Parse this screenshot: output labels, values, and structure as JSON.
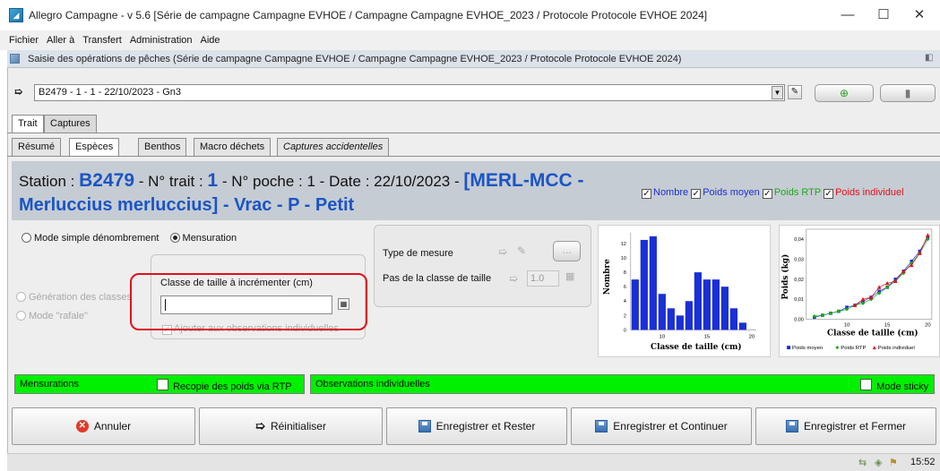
{
  "window": {
    "title": "Allegro Campagne - v 5.6 [Série de campagne Campagne EVHOE / Campagne Campagne EVHOE_2023 / Protocole Protocole EVHOE 2024]"
  },
  "menu": [
    "Fichier",
    "Aller à",
    "Transfert",
    "Administration",
    "Aide"
  ],
  "frame": {
    "title": "Saisie des opérations de pêches (Série de campagne Campagne EVHOE / Campagne Campagne EVHOE_2023 / Protocole Protocole EVHOE 2024)"
  },
  "trip_selector": {
    "value": "B2479 - 1 - 1 - 22/10/2023 - Gn3"
  },
  "top_tabs": [
    "Trait",
    "Captures"
  ],
  "sub_tabs": [
    "Résumé",
    "Espèces",
    "Benthos",
    "Macro déchets",
    "Captures accidentelles"
  ],
  "station": {
    "station_label": "Station : ",
    "station_value": "B2479",
    "trait_label": " - N° trait : ",
    "trait_value": "1",
    "poche_text": " - N° poche : 1 - Date : 22/10/2023 - ",
    "species_part1": "[MERL-MCC -",
    "species_part2": "Merluccius merluccius] - Vrac - P - Petit"
  },
  "legend_checks": {
    "nombre": "Nombre",
    "poids_moyen": "Poids moyen",
    "poids_rtp": "Poids RTP",
    "poids_individuel": "Poids individuel",
    "colors": {
      "nombre": "#1a2fd6",
      "poids_moyen": "#1a2fd6",
      "poids_rtp": "#1aa81a",
      "poids_individuel": "#e0111c"
    }
  },
  "mode": {
    "simple": "Mode simple dénombrement",
    "mensuration": "Mensuration",
    "generation": "Génération des classes",
    "rafale": "Mode \"rafale\""
  },
  "classe": {
    "label": "Classe de taille à incrémenter (cm)",
    "value": "",
    "add_obs": "Ajouter aux observations individuelles"
  },
  "mesure": {
    "type_label": "Type de mesure",
    "pas_label": "Pas de la classe de taille",
    "pas_value": "1.0",
    "dots_button": "..."
  },
  "bottom_bars": {
    "mensurations": "Mensurations",
    "recopie": "Recopie des poids via RTP",
    "observations": "Observations individuelles",
    "sticky": "Mode sticky"
  },
  "buttons": {
    "annuler": "Annuler",
    "reinitialiser": "Réinitialiser",
    "enregistrer_rester": "Enregistrer et Rester",
    "enregistrer_continuer": "Enregistrer et Continuer",
    "enregistrer_fermer": "Enregistrer et Fermer"
  },
  "status": {
    "time": "15:52"
  },
  "chart_data": [
    {
      "type": "bar",
      "xlabel": "Classe de taille (cm)",
      "ylabel": "Nombre",
      "x": [
        7,
        8,
        9,
        10,
        11,
        12,
        13,
        14,
        15,
        16,
        17,
        18,
        19
      ],
      "values": [
        7,
        12.5,
        13,
        5,
        3,
        2,
        4,
        8,
        7,
        7,
        6,
        3,
        1
      ],
      "xticks": [
        "10",
        "15",
        "20"
      ],
      "yticks": [
        "0",
        "2",
        "4",
        "6",
        "8",
        "10",
        "12"
      ],
      "ylim": [
        0,
        13.5
      ],
      "xlim": [
        6.5,
        20.5
      ],
      "color": "#1a2fd6"
    },
    {
      "type": "scatter",
      "xlabel": "Classe de taille (cm)",
      "ylabel": "Poids (kg)",
      "xticks": [
        "10",
        "15",
        "20"
      ],
      "yticks": [
        "0,00",
        "0,01",
        "0,02",
        "0,03",
        "0,04"
      ],
      "xlim": [
        5,
        20.5
      ],
      "ylim": [
        0,
        0.045
      ],
      "series": [
        {
          "name": "Poids moyen",
          "marker": "square",
          "color": "#1a2fd6",
          "points": [
            [
              6,
              0.001
            ],
            [
              7,
              0.002
            ],
            [
              8,
              0.003
            ],
            [
              9,
              0.004
            ],
            [
              10,
              0.006
            ],
            [
              11,
              0.007
            ],
            [
              12,
              0.009
            ],
            [
              13,
              0.011
            ],
            [
              14,
              0.014
            ],
            [
              15,
              0.016
            ],
            [
              16,
              0.02
            ],
            [
              17,
              0.024
            ],
            [
              18,
              0.029
            ],
            [
              19,
              0.034
            ],
            [
              20,
              0.041
            ]
          ]
        },
        {
          "name": "Poids RTP",
          "marker": "diamond",
          "color": "#1aa81a",
          "points": [
            [
              6,
              0.0015
            ],
            [
              7,
              0.002
            ],
            [
              8,
              0.003
            ],
            [
              9,
              0.004
            ],
            [
              10,
              0.005
            ],
            [
              11,
              0.007
            ],
            [
              12,
              0.008
            ],
            [
              13,
              0.01
            ],
            [
              14,
              0.013
            ],
            [
              15,
              0.016
            ],
            [
              16,
              0.019
            ],
            [
              17,
              0.023
            ],
            [
              18,
              0.028
            ],
            [
              19,
              0.033
            ],
            [
              20,
              0.04
            ]
          ]
        },
        {
          "name": "Poids individuel",
          "marker": "triangle",
          "color": "#e0111c",
          "points": [
            [
              11,
              0.007
            ],
            [
              12,
              0.01
            ],
            [
              13,
              0.011
            ],
            [
              14,
              0.016
            ],
            [
              15,
              0.018
            ],
            [
              16,
              0.019
            ],
            [
              17,
              0.024
            ],
            [
              18,
              0.027
            ],
            [
              19,
              0.033
            ],
            [
              20,
              0.042
            ]
          ]
        }
      ]
    }
  ]
}
